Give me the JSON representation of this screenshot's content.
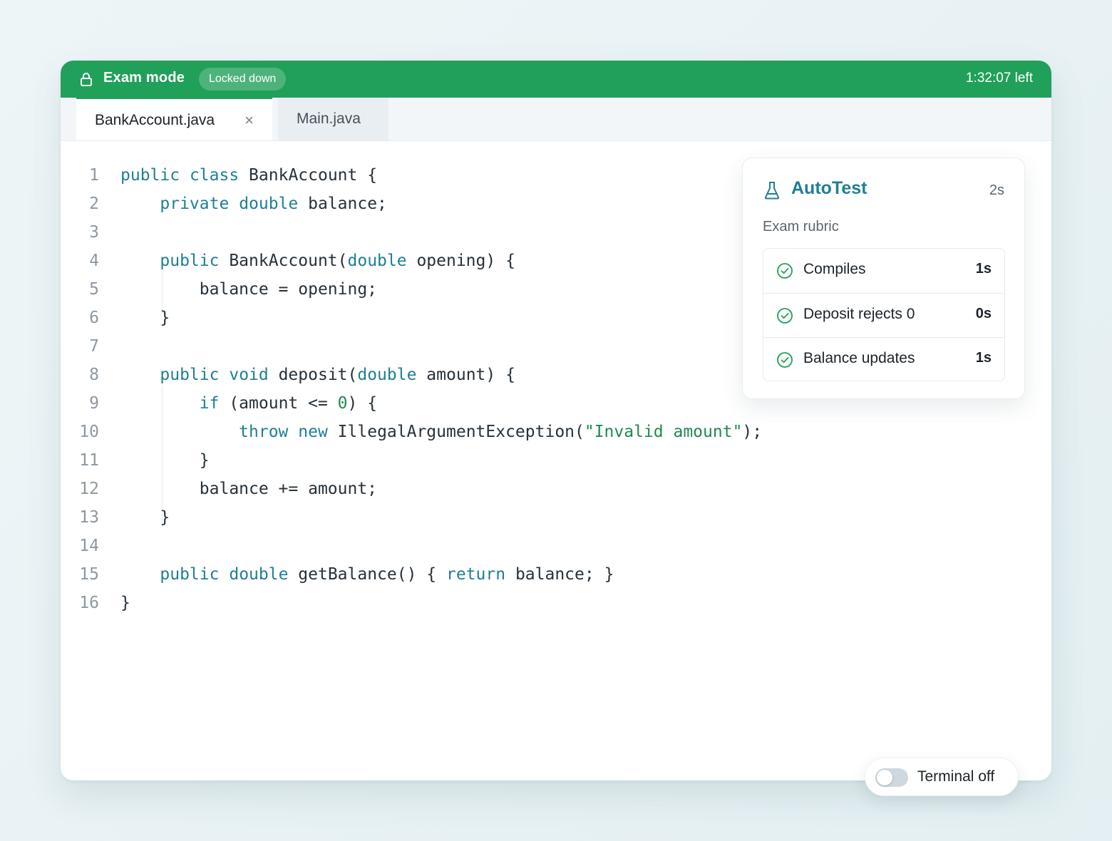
{
  "topbar": {
    "title": "Exam mode",
    "badge": "Locked down",
    "timer": "1:32:07 left",
    "color": "#21a05a"
  },
  "tabs": [
    {
      "label": "BankAccount.java",
      "active": true,
      "close": "×"
    },
    {
      "label": "Main.java",
      "active": false
    }
  ],
  "editor": {
    "lines": [
      {
        "n": "1",
        "tokens": [
          [
            "kw",
            "public"
          ],
          [
            "t",
            " "
          ],
          [
            "kw",
            "class"
          ],
          [
            "t",
            " BankAccount {"
          ]
        ]
      },
      {
        "n": "2",
        "tokens": [
          [
            "t",
            "    "
          ],
          [
            "kw",
            "private"
          ],
          [
            "t",
            " "
          ],
          [
            "kw",
            "double"
          ],
          [
            "t",
            " balance;"
          ]
        ]
      },
      {
        "n": "3",
        "tokens": []
      },
      {
        "n": "4",
        "tokens": [
          [
            "t",
            "    "
          ],
          [
            "kw",
            "public"
          ],
          [
            "t",
            " BankAccount("
          ],
          [
            "kw",
            "double"
          ],
          [
            "t",
            " opening) {"
          ]
        ]
      },
      {
        "n": "5",
        "tokens": [
          [
            "t",
            "        balance = opening;"
          ]
        ]
      },
      {
        "n": "6",
        "tokens": [
          [
            "t",
            "    }"
          ]
        ]
      },
      {
        "n": "7",
        "tokens": []
      },
      {
        "n": "8",
        "tokens": [
          [
            "t",
            "    "
          ],
          [
            "kw",
            "public"
          ],
          [
            "t",
            " "
          ],
          [
            "kw",
            "void"
          ],
          [
            "t",
            " deposit("
          ],
          [
            "kw",
            "double"
          ],
          [
            "t",
            " amount) {"
          ]
        ]
      },
      {
        "n": "9",
        "tokens": [
          [
            "t",
            "        "
          ],
          [
            "kw",
            "if"
          ],
          [
            "t",
            " (amount <= "
          ],
          [
            "num",
            "0"
          ],
          [
            "t",
            ") {"
          ]
        ]
      },
      {
        "n": "10",
        "tokens": [
          [
            "t",
            "            "
          ],
          [
            "kw",
            "throw"
          ],
          [
            "t",
            " "
          ],
          [
            "kw",
            "new"
          ],
          [
            "t",
            " IllegalArgumentException("
          ],
          [
            "str",
            "\"Invalid amount\""
          ],
          [
            "t",
            ");"
          ]
        ]
      },
      {
        "n": "11",
        "tokens": [
          [
            "t",
            "        }"
          ]
        ]
      },
      {
        "n": "12",
        "tokens": [
          [
            "t",
            "        balance += amount;"
          ]
        ]
      },
      {
        "n": "13",
        "tokens": [
          [
            "t",
            "    }"
          ]
        ]
      },
      {
        "n": "14",
        "tokens": []
      },
      {
        "n": "15",
        "tokens": [
          [
            "t",
            "    "
          ],
          [
            "kw",
            "public"
          ],
          [
            "t",
            " "
          ],
          [
            "kw",
            "double"
          ],
          [
            "t",
            " getBalance() { "
          ],
          [
            "kw",
            "return"
          ],
          [
            "t",
            " balance; }"
          ]
        ]
      },
      {
        "n": "16",
        "tokens": [
          [
            "t",
            "}"
          ]
        ]
      }
    ]
  },
  "autotest": {
    "title": "AutoTest",
    "time": "2s",
    "subtitle": "Exam rubric",
    "checks": [
      {
        "label": "Compiles",
        "time": "1s",
        "status": "passed"
      },
      {
        "label": "Deposit rejects 0",
        "time": "0s",
        "status": "passed"
      },
      {
        "label": "Balance updates",
        "time": "1s",
        "status": "passed"
      }
    ]
  },
  "terminal": {
    "label": "Terminal off",
    "enabled": false
  }
}
